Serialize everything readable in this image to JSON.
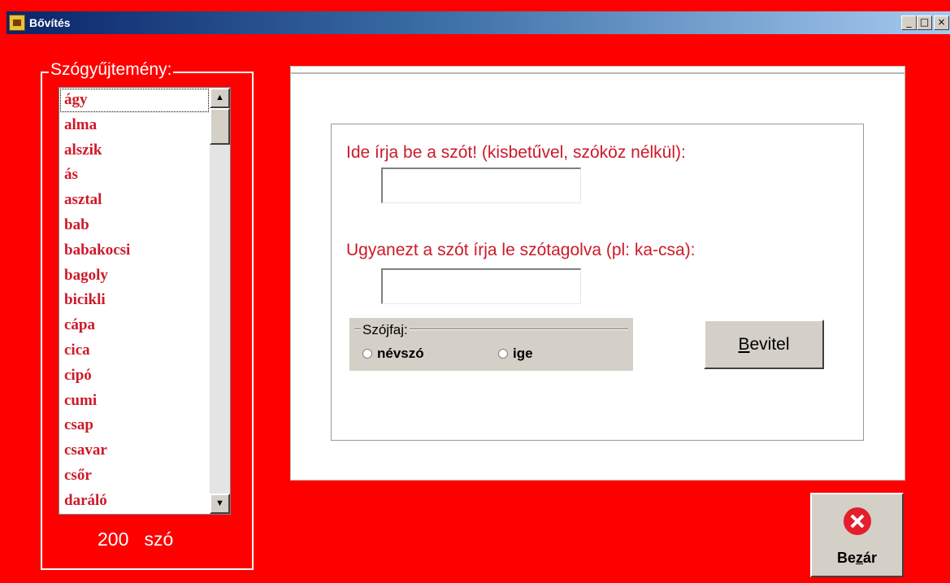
{
  "window": {
    "title": "Bővítés",
    "controls": {
      "minimize": "_",
      "maximize": "□",
      "close": "×"
    }
  },
  "word_list": {
    "group_title": "Szógyűjtemény:",
    "items": [
      "ágy",
      "alma",
      "alszik",
      "ás",
      "asztal",
      "bab",
      "babakocsi",
      "bagoly",
      "bicikli",
      "cápa",
      "cica",
      "cipó",
      "cumi",
      "csap",
      "csavar",
      "csőr",
      "daráló"
    ],
    "selected": "ágy",
    "count": "200",
    "count_unit": "szó"
  },
  "form": {
    "word_label": "Ide írja be a szót! (kisbetűvel, szóköz nélkül):",
    "word_value": "",
    "syllable_label": "Ugyanezt a szót írja le szótagolva (pl: ka-csa):",
    "syllable_value": "",
    "pos_group_title": "Szójfaj:",
    "pos_options": [
      "névszó",
      "ige"
    ],
    "submit_label": "Bevitel",
    "submit_accel": "B"
  },
  "close_button": {
    "label": "Bezár",
    "accel": "z"
  },
  "colors": {
    "background": "#ff0000",
    "list_text": "#cc1a28",
    "label_text": "#cc1a28"
  }
}
